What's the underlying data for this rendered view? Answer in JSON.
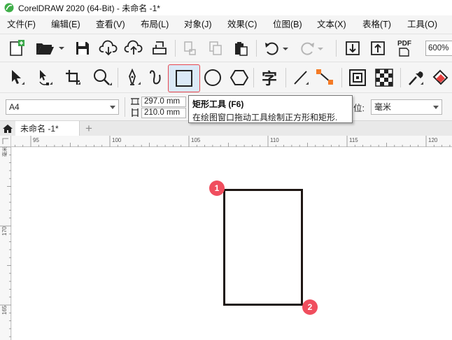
{
  "window": {
    "title": "CorelDRAW 2020 (64-Bit) - 未命名 -1*"
  },
  "menu": [
    {
      "label": "文件(F)"
    },
    {
      "label": "编辑(E)"
    },
    {
      "label": "查看(V)"
    },
    {
      "label": "布局(L)"
    },
    {
      "label": "对象(J)"
    },
    {
      "label": "效果(C)"
    },
    {
      "label": "位图(B)"
    },
    {
      "label": "文本(X)"
    },
    {
      "label": "表格(T)"
    },
    {
      "label": "工具(O)"
    }
  ],
  "standard_toolbar": {
    "zoom_value": "600%",
    "pdf_label": "PDF"
  },
  "toolbox": {
    "text_tool_glyph": "字",
    "active_tool": "rectangle-tool"
  },
  "property_bar": {
    "page_size": "A4",
    "width_value": "297.0 mm",
    "height_value": "210.0 mm",
    "units_label": "位:",
    "units_value": "毫米"
  },
  "tooltip": {
    "title": "矩形工具 (F6)",
    "description": "在绘图窗口拖动工具绘制正方形和矩形."
  },
  "document_tab": {
    "name": "未命名 -1*",
    "add_label": "+"
  },
  "rulers": {
    "units": "毫米",
    "horizontal_labels": [
      "95",
      "100",
      "105",
      "110",
      "115",
      "120"
    ],
    "vertical_labels": [
      "170",
      "165"
    ]
  },
  "markers": [
    {
      "label": "1"
    },
    {
      "label": "2"
    }
  ],
  "colors": {
    "highlight": "#e8474f",
    "marker": "#f04e5e",
    "rect_stroke": "#1f1714"
  }
}
